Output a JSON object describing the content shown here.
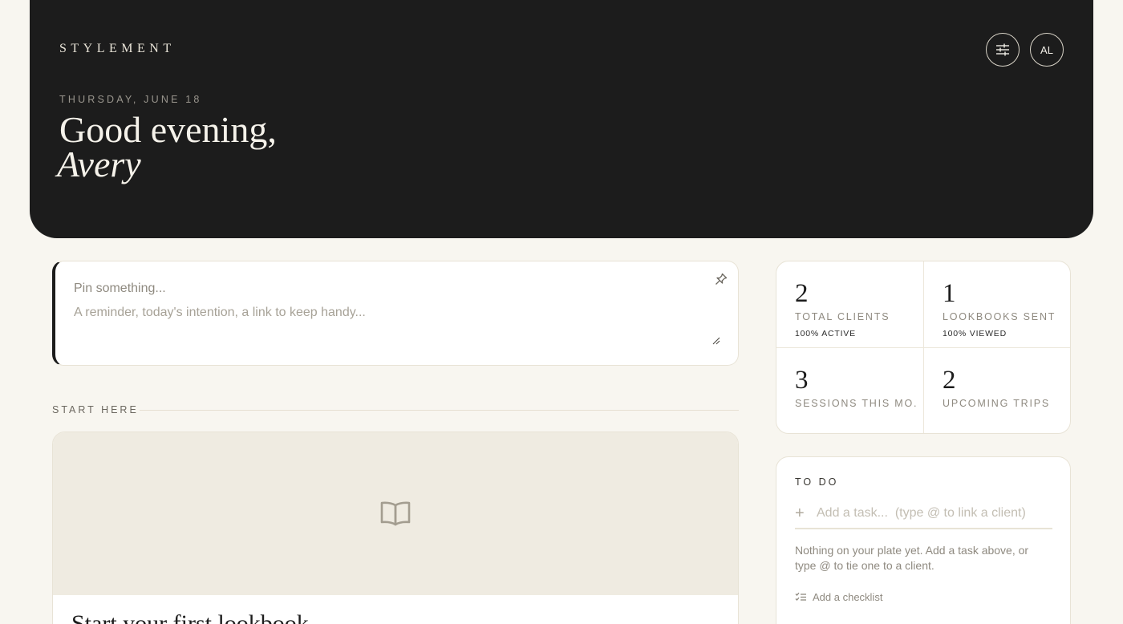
{
  "hero": {
    "brand": "STYLEMENT",
    "date": "THURSDAY, JUNE 18",
    "greeting": "Good evening,",
    "name": "Avery",
    "avatar_initials": "AL"
  },
  "pin": {
    "title_placeholder": "Pin something...",
    "body_placeholder": "A reminder, today's intention, a link to keep handy..."
  },
  "start_here": {
    "label": "START HERE",
    "card_title": "Start your first lookbook"
  },
  "stats": [
    {
      "value": "2",
      "label": "TOTAL CLIENTS",
      "note": "100% ACTIVE"
    },
    {
      "value": "1",
      "label": "LOOKBOOKS SENT",
      "note": "100% VIEWED"
    },
    {
      "value": "3",
      "label": "SESSIONS THIS MO.",
      "note": ""
    },
    {
      "value": "2",
      "label": "UPCOMING TRIPS",
      "note": ""
    }
  ],
  "todo": {
    "label": "TO DO",
    "placeholder": "Add a task...  (type @ to link a client)",
    "empty_message": "Nothing on your plate yet. Add a task above, or type @ to tie one to a client.",
    "checklist_label": "Add a checklist"
  },
  "colors": {
    "page_bg": "#f8f6f0",
    "hero_bg": "#1c1c1c",
    "cover_bg": "#efebe1",
    "accent_ink": "#1c1c1c"
  },
  "icons": {
    "settings": "sliders-icon",
    "pin": "pin-icon",
    "resize": "resize-handle-icon",
    "lookbook": "open-book-icon",
    "add": "plus-icon",
    "checklist": "checklist-icon"
  }
}
